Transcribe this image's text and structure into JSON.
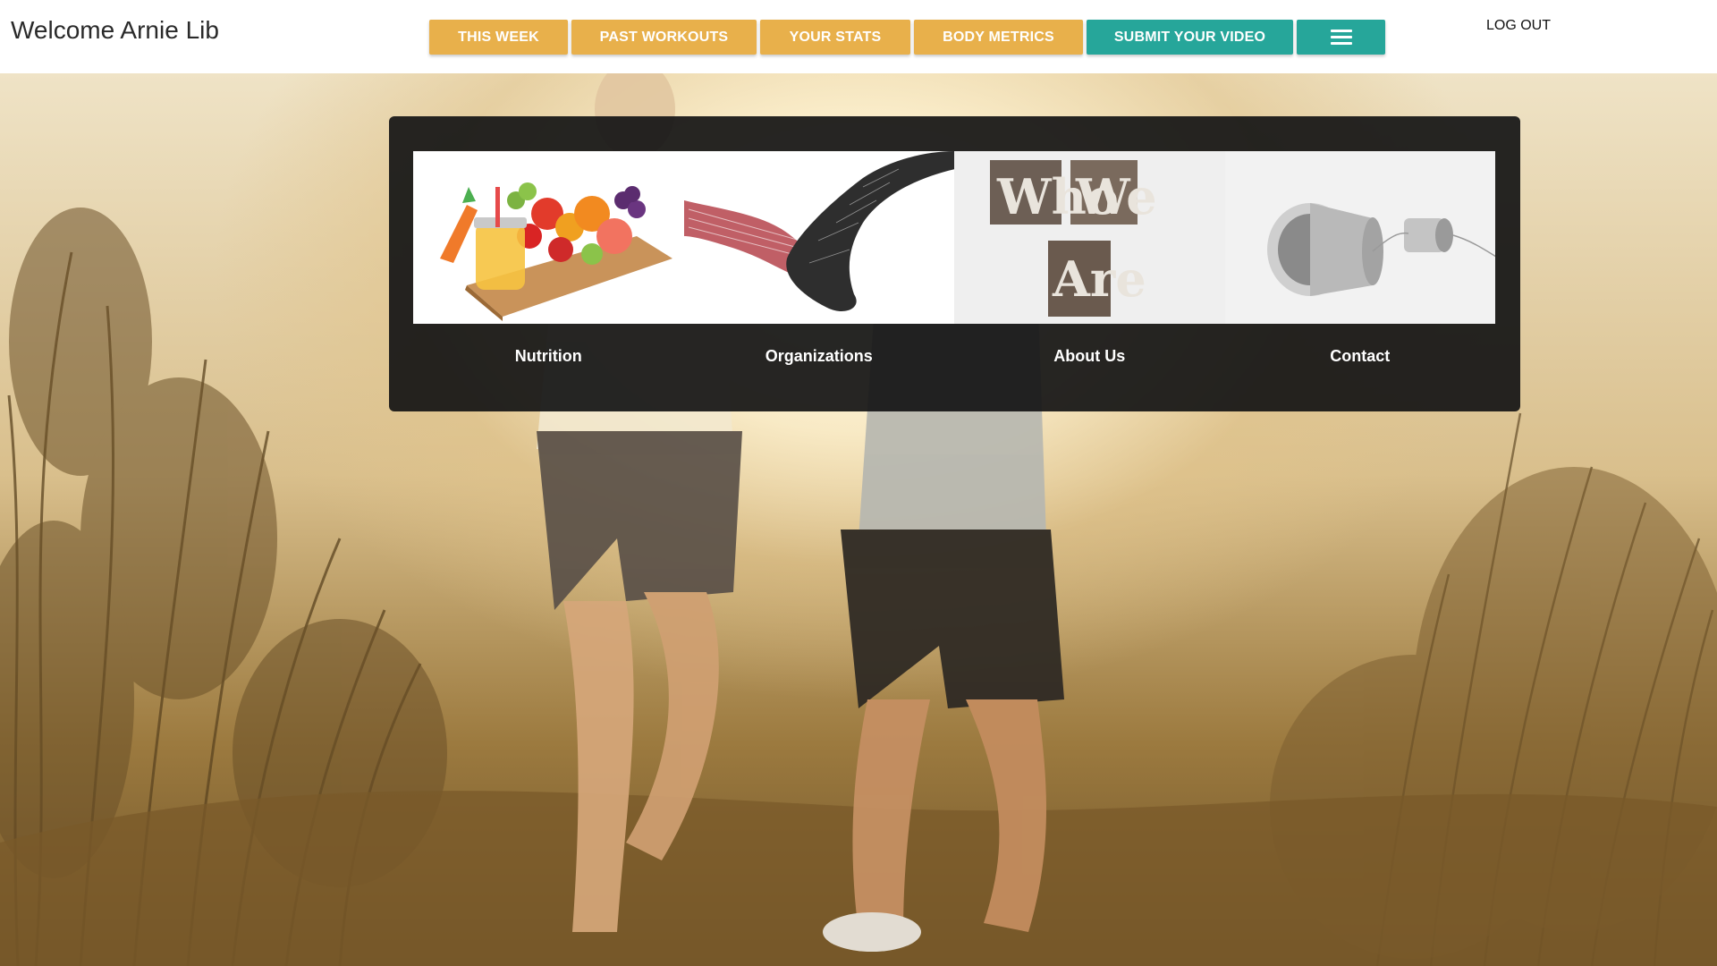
{
  "header": {
    "welcome": "Welcome Arnie Lib",
    "nav": [
      {
        "label": "THIS WEEK",
        "color": "#e8b04b"
      },
      {
        "label": "PAST WORKOUTS",
        "color": "#e8b04b"
      },
      {
        "label": "YOUR STATS",
        "color": "#e8b04b"
      },
      {
        "label": "BODY METRICS",
        "color": "#e8b04b"
      },
      {
        "label": "SUBMIT YOUR VIDEO",
        "color": "#26a69a"
      }
    ],
    "menu_icon": "hamburger-menu-icon",
    "logout": "LOG OUT"
  },
  "panel": {
    "tiles": [
      {
        "label": "Nutrition",
        "image": "fruit-vegetables-jar-image"
      },
      {
        "label": "Organizations",
        "image": "holding-hands-words-image"
      },
      {
        "label": "About Us",
        "image": "who-we-are-letters-image",
        "image_text": [
          "Who",
          "We",
          "Are"
        ]
      },
      {
        "label": "Contact",
        "image": "tin-can-phone-image"
      }
    ]
  },
  "background": {
    "image": "couple-running-field-photo"
  },
  "colors": {
    "gold": "#e8b04b",
    "teal": "#26a69a",
    "panel": "#161616"
  }
}
